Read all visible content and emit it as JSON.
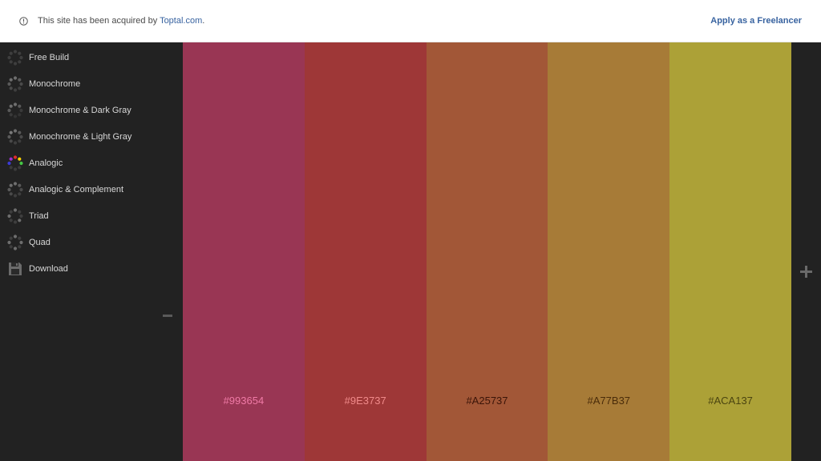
{
  "banner": {
    "message": "This site has been acquired by ",
    "link_text": "Toptal.com",
    "link_suffix": ".",
    "cta": "Apply as a Freelancer"
  },
  "sidebar": {
    "items": [
      {
        "label": "Free Build",
        "icon": "free-build-icon"
      },
      {
        "label": "Monochrome",
        "icon": "monochrome-icon"
      },
      {
        "label": "Monochrome & Dark Gray",
        "icon": "monochrome-dark-gray-icon"
      },
      {
        "label": "Monochrome & Light Gray",
        "icon": "monochrome-light-gray-icon"
      },
      {
        "label": "Analogic",
        "icon": "analogic-icon"
      },
      {
        "label": "Analogic & Complement",
        "icon": "analogic-complement-icon"
      },
      {
        "label": "Triad",
        "icon": "triad-icon"
      },
      {
        "label": "Quad",
        "icon": "quad-icon"
      },
      {
        "label": "Download",
        "icon": "floppy-disk-icon"
      }
    ]
  },
  "palette": {
    "swatches": [
      {
        "hex": "#993654",
        "color": "#993654",
        "text_color": "#f07aa6"
      },
      {
        "hex": "#9E3737",
        "color": "#9E3737",
        "text_color": "#f08a8a"
      },
      {
        "hex": "#A25737",
        "color": "#A25737",
        "text_color": "#3a1408"
      },
      {
        "hex": "#A77B37",
        "color": "#A77B37",
        "text_color": "#4a2c0a"
      },
      {
        "hex": "#ACA137",
        "color": "#ACA137",
        "text_color": "#4a4410"
      }
    ]
  },
  "colors": {
    "background": "#222222",
    "link": "#3863a0"
  }
}
